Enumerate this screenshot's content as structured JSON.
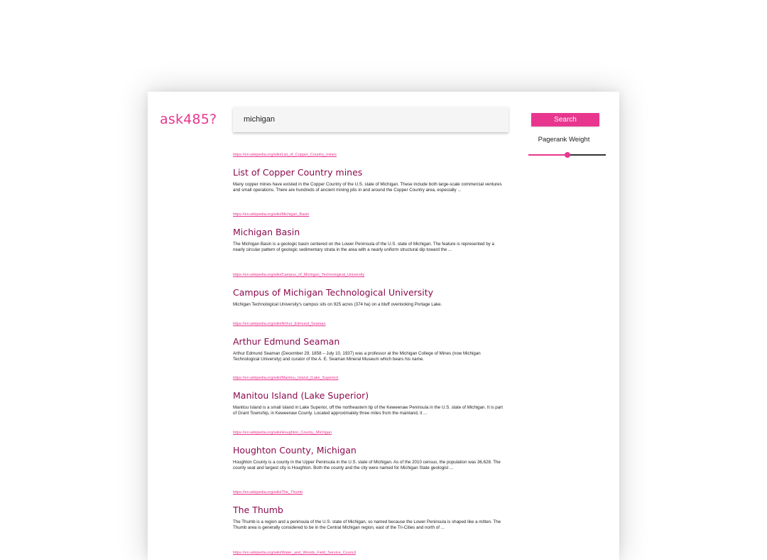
{
  "app": {
    "logo": "ask485?"
  },
  "search": {
    "query": "michigan",
    "button_label": "Search"
  },
  "pagerank": {
    "label": "Pagerank Weight",
    "value": 0.5
  },
  "results": [
    {
      "url": "https://en.wikipedia.org/wiki/List_of_Copper_Country_mines",
      "title": "List of Copper Country mines",
      "snippet": "Many copper mines have existed in the Copper Country of the U.S. state of Michigan. These include both large-scale commercial ventures and small operations. There are hundreds of ancient mining pits in and around the Copper Country area, especially ..."
    },
    {
      "url": "https://en.wikipedia.org/wiki/Michigan_Basin",
      "title": "Michigan Basin",
      "snippet": "The Michigan Basin is a geologic basin centered on the Lower Peninsula of the U.S. state of Michigan. The feature is represented by a nearly circular pattern of geologic sedimentary strata in the area with a nearly uniform structural dip toward the ..."
    },
    {
      "url": "https://en.wikipedia.org/wiki/Campus_of_Michigan_Technological_University",
      "title": "Campus of Michigan Technological University",
      "snippet": "Michigan Technological University's campus sits on 925 acres (374 ha) on a bluff overlooking Portage Lake."
    },
    {
      "url": "https://en.wikipedia.org/wiki/Arthur_Edmund_Seaman",
      "title": "Arthur Edmund Seaman",
      "snippet": "Arthur Edmund Seaman (December 29, 1858 – July 10, 1937) was a professor at the Michigan College of Mines (now Michigan Technological University) and curator of the A. E. Seaman Mineral Museum which bears his name."
    },
    {
      "url": "https://en.wikipedia.org/wiki/Manitou_Island_(Lake_Superior)",
      "title": "Manitou Island (Lake Superior)",
      "snippet": "Manitou Island is a small island in Lake Superior, off the northeastern tip of the Keweenaw Peninsula in the U.S. state of Michigan. It is part of Grant Township, in Keweenaw County. Located approximately three miles from the mainland, it ..."
    },
    {
      "url": "https://en.wikipedia.org/wiki/Houghton_County,_Michigan",
      "title": "Houghton County, Michigan",
      "snippet": "Houghton County is a county in the Upper Peninsula in the U.S. state of Michigan. As of the 2010 census, the population was 36,628. The county seat and largest city is Houghton. Both the county and the city were named for Michigan State geologist ..."
    },
    {
      "url": "https://en.wikipedia.org/wiki/The_Thumb",
      "title": "The Thumb",
      "snippet": "The Thumb is a region and a peninsula of the U.S. state of Michigan, so named because the Lower Peninsula is shaped like a mitten. The Thumb area is generally considered to be in the Central Michigan region, east of the Tri-Cities and north of ..."
    },
    {
      "url": "https://en.wikipedia.org/wiki/Water_and_Woods_Field_Service_Council",
      "title": "",
      "snippet": ""
    }
  ]
}
